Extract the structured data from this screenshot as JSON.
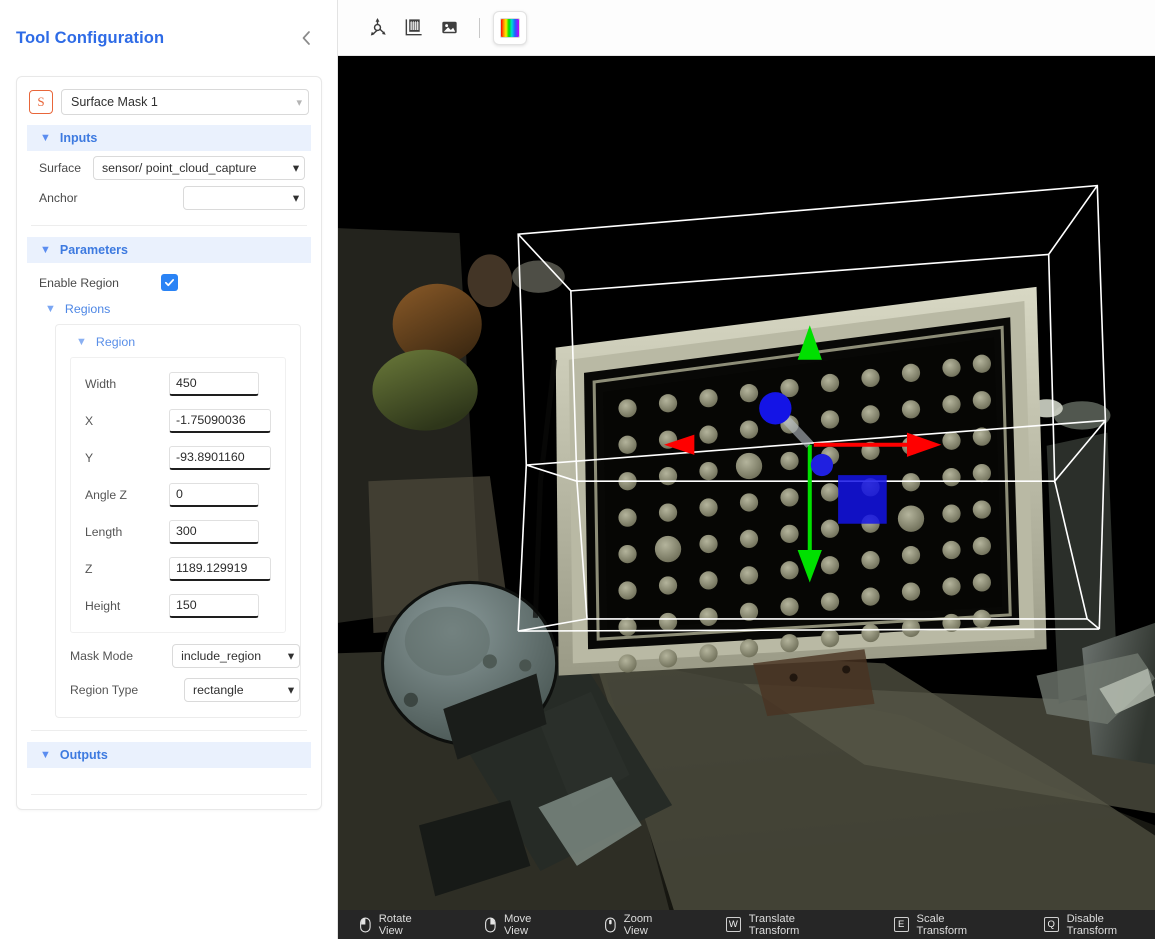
{
  "panel": {
    "title": "Tool Configuration",
    "collapse_icon": "chevron-left-icon",
    "tool": {
      "badge": "S",
      "name": "Surface Mask 1"
    },
    "sections": {
      "inputs_label": "Inputs",
      "parameters_label": "Parameters",
      "regions_label": "Regions",
      "region_label": "Region",
      "outputs_label": "Outputs"
    },
    "inputs": [
      {
        "label": "Surface",
        "value": "sensor/ point_cloud_capture"
      },
      {
        "label": "Anchor",
        "value": ""
      }
    ],
    "enable_region": {
      "label": "Enable Region",
      "checked": true,
      "color": "#2a83f5"
    },
    "region_params": [
      {
        "label": "Width",
        "value": "450"
      },
      {
        "label": "X",
        "value": "-1.75090036"
      },
      {
        "label": "Y",
        "value": "-93.8901160"
      },
      {
        "label": "Angle Z",
        "value": "0"
      },
      {
        "label": "Length",
        "value": "300"
      },
      {
        "label": "Z",
        "value": "1189.129919"
      },
      {
        "label": "Height",
        "value": "150"
      }
    ],
    "mask_mode": {
      "label": "Mask Mode",
      "value": "include_region"
    },
    "region_type": {
      "label": "Region Type",
      "value": "rectangle"
    }
  },
  "viewport": {
    "toolbar": [
      {
        "name": "axes-icon",
        "title": "3D Axes"
      },
      {
        "name": "grid-icon",
        "title": "Grid"
      },
      {
        "name": "image-icon",
        "title": "Image"
      },
      {
        "name": "spectrum-icon",
        "title": "Color Map"
      }
    ],
    "statusbar": [
      {
        "icon": "mouse-left-icon",
        "label": "Rotate View"
      },
      {
        "icon": "mouse-right-icon",
        "label": "Move View"
      },
      {
        "icon": "mouse-middle-icon",
        "label": "Zoom View"
      },
      {
        "icon": "key-w",
        "key": "W",
        "label": "Translate Transform"
      },
      {
        "icon": "key-e",
        "key": "E",
        "label": "Scale Transform"
      },
      {
        "icon": "key-q",
        "key": "Q",
        "label": "Disable Transform"
      }
    ],
    "gizmo": {
      "x_axis_color": "#ff0000",
      "y_axis_color": "#00e000",
      "z_axis_color": "#1414e6"
    },
    "region_box_color": "#ffffff"
  }
}
